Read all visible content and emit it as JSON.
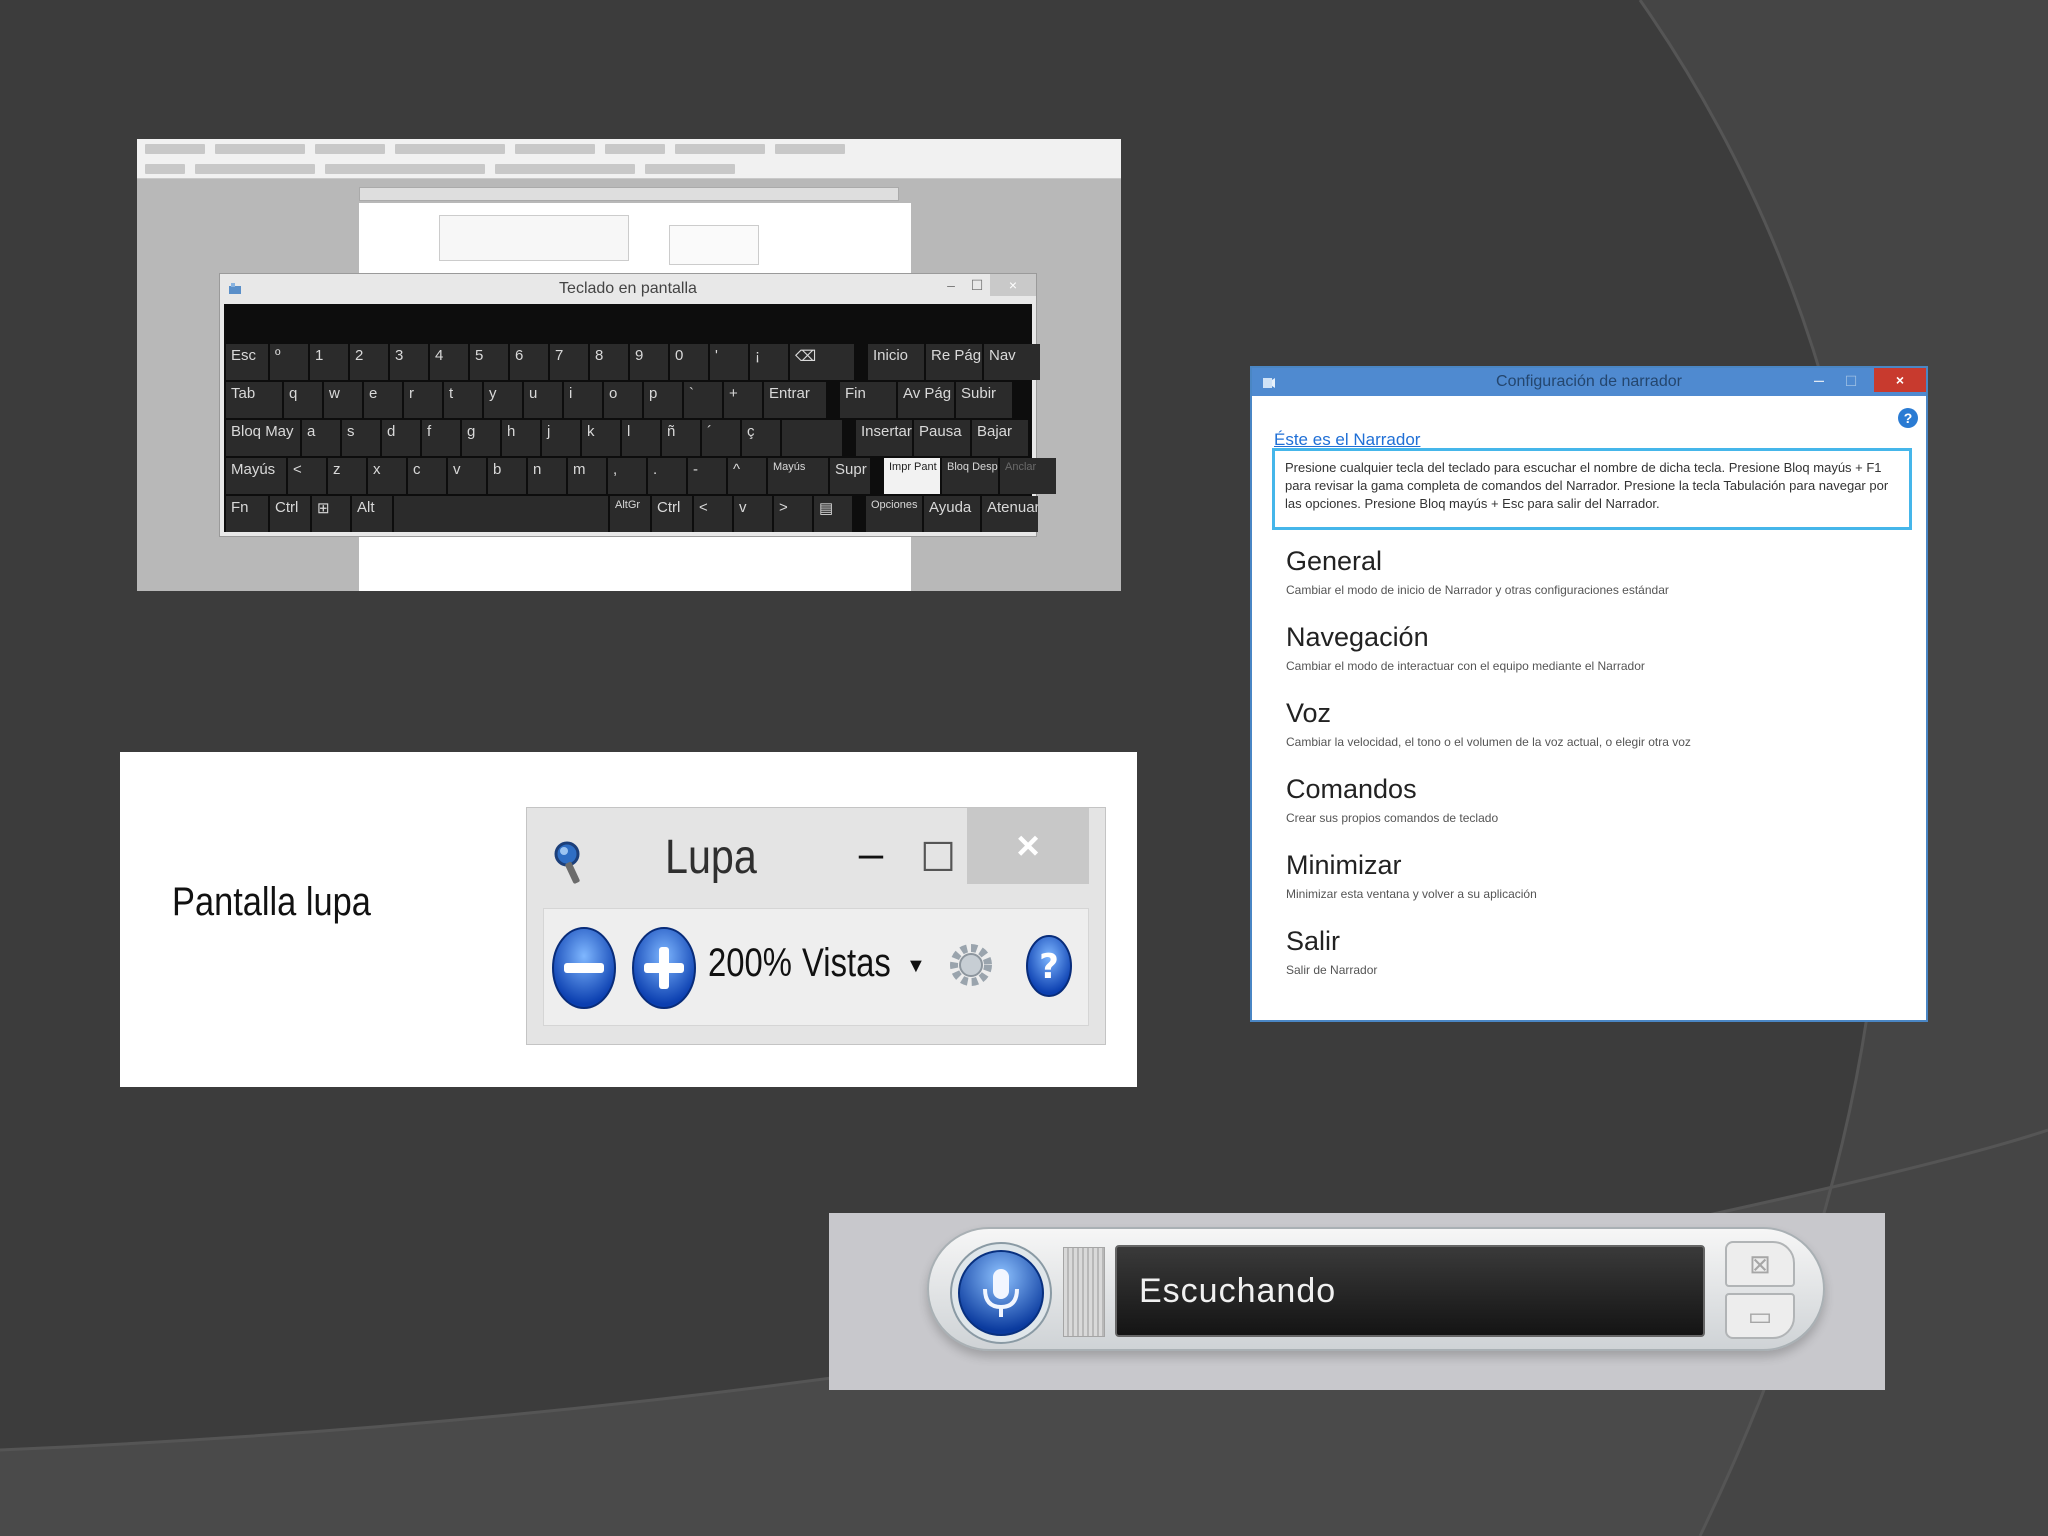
{
  "colors": {
    "background": "#3c3c3c",
    "narrator_titlebar": "#4f8ad0",
    "narrator_link": "#1f6fd6",
    "narrator_highlight": "#45b6ea",
    "close_red": "#c83a2e",
    "speech_status_bg": "#141414"
  },
  "osk": {
    "title": "Teclado en pantalla",
    "minimize_icon": "–",
    "maximize_icon": "☐",
    "close_icon": "×",
    "rows": [
      [
        "Esc",
        "º",
        "1",
        "2",
        "3",
        "4",
        "5",
        "6",
        "7",
        "8",
        "9",
        "0",
        "'",
        "¡",
        "⌫",
        "Inicio",
        "Re Pág",
        "Nav"
      ],
      [
        "Tab",
        "q",
        "w",
        "e",
        "r",
        "t",
        "y",
        "u",
        "i",
        "o",
        "p",
        "`",
        "+",
        "Entrar",
        "Fin",
        "Av Pág",
        "Subir"
      ],
      [
        "Bloq May",
        "a",
        "s",
        "d",
        "f",
        "g",
        "h",
        "j",
        "k",
        "l",
        "ñ",
        "´",
        "ç",
        "",
        "Insertar",
        "Pausa",
        "Bajar"
      ],
      [
        "Mayús",
        "<",
        "z",
        "x",
        "c",
        "v",
        "b",
        "n",
        "m",
        ",",
        ".",
        "-",
        "^",
        "Mayús",
        "Supr",
        "Impr Pant",
        "Bloq Despl",
        "Anclar"
      ],
      [
        "Fn",
        "Ctrl",
        "⊞",
        "Alt",
        "",
        "AltGr",
        "Ctrl",
        "<",
        "v",
        ">",
        "▤",
        "Opciones",
        "Ayuda",
        "Atenuar"
      ]
    ]
  },
  "lupa": {
    "caption": "Pantalla lupa",
    "title": "Lupa",
    "minimize_icon": "–",
    "maximize_icon": "☐",
    "close_icon": "×",
    "zoom_level": "200%",
    "views_label": "Vistas",
    "caret": "▼",
    "icons": [
      "magnifier-icon",
      "zoom-out-icon",
      "zoom-in-icon",
      "gear-icon",
      "help-icon"
    ]
  },
  "narrator": {
    "title": "Configuración de narrador",
    "minimize_icon": "–",
    "maximize_icon": "☐",
    "close_icon": "×",
    "help_icon": "?",
    "link": "Éste es el Narrador",
    "description": "Presione cualquier tecla del teclado para escuchar el nombre de dicha tecla. Presione Bloq mayús + F1 para revisar la gama completa de comandos del Narrador. Presione la tecla Tabulación para navegar por las opciones. Presione Bloq mayús + Esc para salir del Narrador.",
    "items": [
      {
        "label": "General",
        "desc": "Cambiar el modo de inicio de Narrador y otras configuraciones estándar"
      },
      {
        "label": "Navegación",
        "desc": "Cambiar el modo de interactuar con el equipo mediante el Narrador"
      },
      {
        "label": "Voz",
        "desc": "Cambiar la velocidad, el tono o el volumen de la voz actual, o elegir otra voz"
      },
      {
        "label": "Comandos",
        "desc": "Crear sus propios comandos de teclado"
      },
      {
        "label": "Minimizar",
        "desc": "Minimizar esta ventana y volver a su aplicación"
      },
      {
        "label": "Salir",
        "desc": "Salir de Narrador"
      }
    ]
  },
  "speech": {
    "status": "Escuchando",
    "close_icon": "⊠",
    "minimize_icon": "▭"
  }
}
